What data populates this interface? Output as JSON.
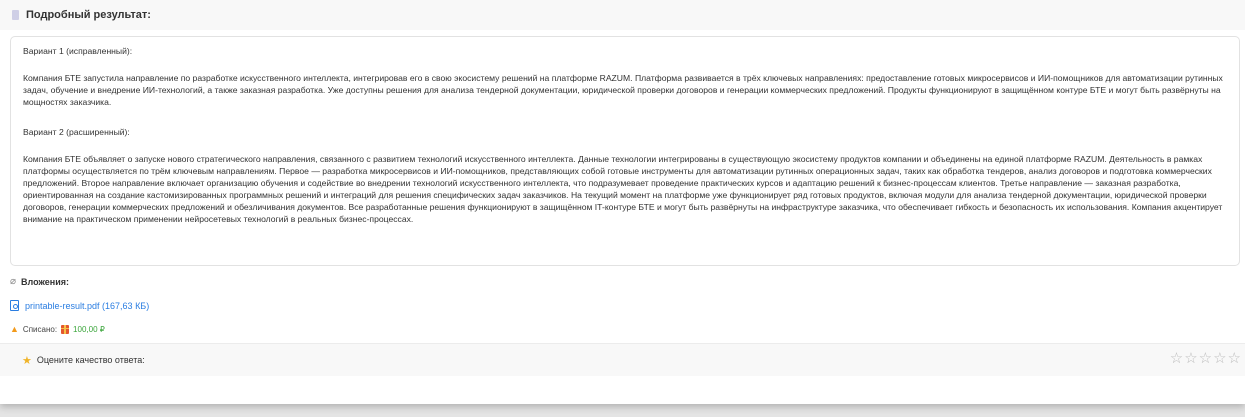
{
  "header": {
    "title": "Подробный результат:"
  },
  "result": {
    "variant1_title": "Вариант 1 (исправленный):",
    "variant1_text": "Компания БТЕ запустила направление по разработке искусственного интеллекта, интегрировав его в свою экосистему решений на платформе RAZUM. Платформа развивается в трёх ключевых направлениях: предоставление готовых микросервисов и ИИ-помощников для автоматизации рутинных задач, обучение и внедрение ИИ-технологий, а также заказная разработка. Уже доступны решения для анализа тендерной документации, юридической проверки договоров и генерации коммерческих предложений. Продукты функционируют в защищённом контуре БТЕ и могут быть развёрнуты на мощностях заказчика.",
    "variant2_title": "Вариант 2 (расширенный):",
    "variant2_text": "Компания БТЕ объявляет о запуске нового стратегического направления, связанного с развитием технологий искусственного интеллекта. Данные технологии интегрированы в существующую экосистему продуктов компании и объединены на единой платформе RAZUM. Деятельность в рамках платформы осуществляется по трём ключевым направлениям. Первое — разработка микросервисов и ИИ-помощников, представляющих собой готовые инструменты для автоматизации рутинных операционных задач, таких как обработка тендеров, анализ договоров и подготовка коммерческих предложений. Второе направление включает организацию обучения и содействие во внедрении технологий искусственного интеллекта, что подразумевает проведение практических курсов и адаптацию решений к бизнес-процессам клиентов. Третье направление — заказная разработка, ориентированная на создание кастомизированных программных решений и интеграций для решения специфических задач заказчиков. На текущий момент на платформе уже функционирует ряд готовых продуктов, включая модули для анализа тендерной документации, юридической проверки договоров, генерации коммерческих предложений и обезличивания документов. Все разработанные решения функционируют в защищённом IT-контуре БТЕ и могут быть развёрнуты на инфраструктуре заказчика, что обеспечивает гибкость и безопасность их использования. Компания акцентирует внимание на практическом применении нейросетевых технологий в реальных бизнес-процессах."
  },
  "attachments": {
    "label": "Вложения:",
    "file": "printable-result.pdf (167,63 КБ)"
  },
  "billing": {
    "label": "Списано:",
    "amount": "100,00 ₽"
  },
  "rating": {
    "label": "Оцените качество ответа:",
    "stars": [
      "☆",
      "☆",
      "☆",
      "☆",
      "☆"
    ]
  },
  "icons": {
    "header": "document-icon",
    "attachments": "paperclip-icon",
    "file": "pdf-file-icon",
    "billing": "coin-icon",
    "gift": "gift-icon",
    "rating": "star-icon"
  },
  "colors": {
    "link": "#2a7de1",
    "amount": "#3aa53a",
    "star_empty": "#bdbdbd",
    "accent": "#f0b429"
  }
}
